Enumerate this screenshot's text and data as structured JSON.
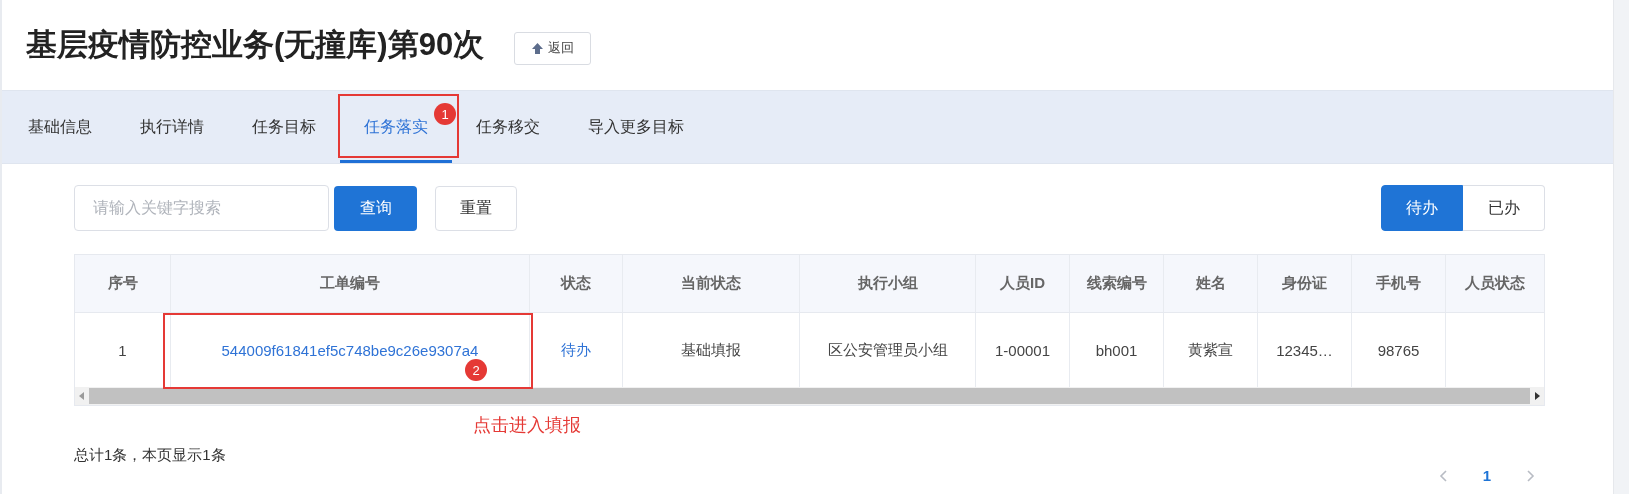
{
  "title": "基层疫情防控业务(无撞库)第90次",
  "back_button": {
    "label": "返回"
  },
  "tabs": [
    {
      "label": "基础信息",
      "selected": false
    },
    {
      "label": "执行详情",
      "selected": false
    },
    {
      "label": "任务目标",
      "selected": false
    },
    {
      "label": "任务落实",
      "selected": true,
      "badge": "1"
    },
    {
      "label": "任务移交",
      "selected": false
    },
    {
      "label": "导入更多目标",
      "selected": false
    }
  ],
  "search": {
    "placeholder": "请输入关键字搜索"
  },
  "query_button": {
    "label": "查询"
  },
  "reset_button": {
    "label": "重置"
  },
  "status_toggle": [
    {
      "label": "待办",
      "selected": true
    },
    {
      "label": "已办",
      "selected": false
    }
  ],
  "table": {
    "columns": [
      "序号",
      "工单编号",
      "状态",
      "当前状态",
      "执行小组",
      "人员ID",
      "线索编号",
      "姓名",
      "身份证",
      "手机号",
      "人员状态"
    ],
    "rows": [
      {
        "cells": [
          {
            "text": "1",
            "kind": "plain"
          },
          {
            "text": "544009f61841ef5c748be9c26e9307a4",
            "kind": "link",
            "badge": "2",
            "note": "点击进入填报"
          },
          {
            "text": "待办",
            "kind": "link"
          },
          {
            "text": "基础填报",
            "kind": "plain"
          },
          {
            "text": "区公安管理员小组",
            "kind": "plain"
          },
          {
            "text": "1-00001",
            "kind": "plain"
          },
          {
            "text": "bh001",
            "kind": "plain"
          },
          {
            "text": "黄紫宣",
            "kind": "plain"
          },
          {
            "text": "12345…",
            "kind": "plain"
          },
          {
            "text": "98765",
            "kind": "plain"
          }
        ]
      }
    ]
  },
  "summary": "总计1条，本页显示1条",
  "pagination": {
    "pages": [
      {
        "label": "1",
        "selected": true
      }
    ]
  }
}
